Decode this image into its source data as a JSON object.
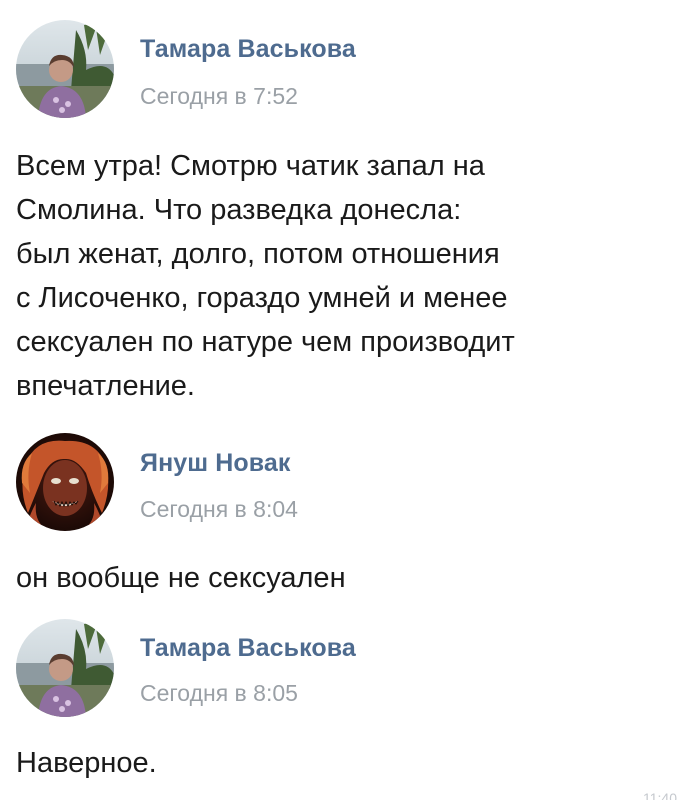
{
  "messages": [
    {
      "author": "Тамара Васькова",
      "time": "Сегодня в 7:52",
      "lines": [
        "Всем утра! Смотрю чатик запал на",
        "Смолина. Что разведка донесла:",
        "был женат, долго, потом отношения",
        "с Лисоченко, гораздо умней и менее",
        "сексуален по натуре чем производит",
        "впечатление."
      ]
    },
    {
      "author": "Януш Новак",
      "time": "Сегодня в 8:04",
      "lines": [
        "он вообще не сексуален"
      ]
    },
    {
      "author": "Тамара Васькова",
      "time": "Сегодня в 8:05",
      "lines": [
        "Наверное."
      ]
    }
  ],
  "corner_time": "11:40",
  "colors": {
    "author": "#4e6b8f",
    "time": "#9aa0a6",
    "text": "#1a1a1a"
  }
}
